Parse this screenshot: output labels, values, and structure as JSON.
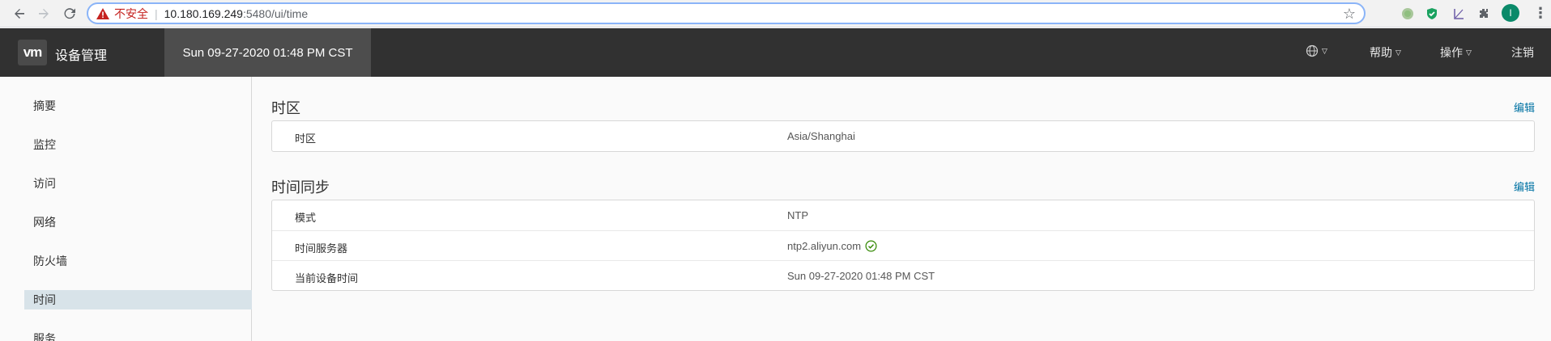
{
  "browser": {
    "insecure_label": "不安全",
    "url_host": "10.180.169.249",
    "url_path": ":5480/ui/time",
    "profile_initial": "I"
  },
  "header": {
    "logo": "vm",
    "title": "设备管理",
    "date": "Sun 09-27-2020 01:48 PM CST",
    "help": "帮助",
    "actions": "操作",
    "logout": "注销"
  },
  "sidebar": {
    "items": [
      {
        "label": "摘要"
      },
      {
        "label": "监控"
      },
      {
        "label": "访问"
      },
      {
        "label": "网络"
      },
      {
        "label": "防火墙"
      },
      {
        "label": "时间"
      },
      {
        "label": "服务"
      }
    ],
    "active": "时间"
  },
  "main": {
    "timezone_section": {
      "title": "时区",
      "edit": "编辑",
      "rows": [
        {
          "label": "时区",
          "value": "Asia/Shanghai"
        }
      ]
    },
    "sync_section": {
      "title": "时间同步",
      "edit": "编辑",
      "rows": [
        {
          "label": "模式",
          "value": "NTP"
        },
        {
          "label": "时间服务器",
          "value": "ntp2.aliyun.com"
        },
        {
          "label": "当前设备时间",
          "value": "Sun 09-27-2020 01:48 PM CST"
        }
      ]
    }
  },
  "colors": {
    "header_bg": "#313131",
    "date_bg": "#4d4d4d",
    "link": "#0072a3",
    "active_nav": "#d8e3e9",
    "ok_green": "#318700"
  }
}
